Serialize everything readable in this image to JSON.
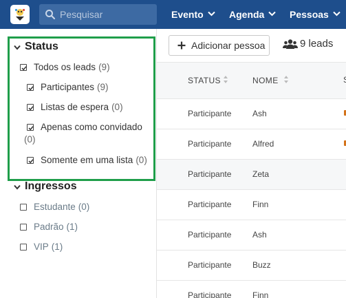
{
  "header": {
    "search_placeholder": "Pesquisar",
    "nav": [
      {
        "label": "Evento"
      },
      {
        "label": "Agenda"
      },
      {
        "label": "Pessoas"
      }
    ]
  },
  "filters": {
    "status": {
      "title": "Status",
      "items": [
        {
          "label": "Todos os leads",
          "count": "(9)",
          "checked": true
        },
        {
          "label": "Participantes",
          "count": "(9)",
          "checked": true
        },
        {
          "label": "Listas de espera",
          "count": "(0)",
          "checked": true
        },
        {
          "label": "Apenas como convidado",
          "count": "(0)",
          "checked": true
        },
        {
          "label": "Somente em uma lista",
          "count": "(0)",
          "checked": true
        }
      ]
    },
    "tickets": {
      "title": "Ingressos",
      "items": [
        {
          "label": "Estudante",
          "count": "(0)",
          "checked": false
        },
        {
          "label": "Padrão",
          "count": "(1)",
          "checked": false
        },
        {
          "label": "VIP",
          "count": "(1)",
          "checked": false
        }
      ]
    }
  },
  "toolbar": {
    "add_label": "Adicionar pessoa",
    "leads_count": "9 leads"
  },
  "table": {
    "columns": [
      "STATUS",
      "NOME",
      "S"
    ],
    "rows": [
      {
        "status": "Participante",
        "name": "Ash"
      },
      {
        "status": "Participante",
        "name": "Alfred"
      },
      {
        "status": "Participante",
        "name": "Zeta"
      },
      {
        "status": "Participante",
        "name": "Finn"
      },
      {
        "status": "Participante",
        "name": "Ash"
      },
      {
        "status": "Participante",
        "name": "Buzz"
      },
      {
        "status": "Participante",
        "name": "Finn"
      }
    ]
  },
  "colors": {
    "header_bg": "#1e4e8c",
    "highlight_border": "#1f9e4a"
  }
}
